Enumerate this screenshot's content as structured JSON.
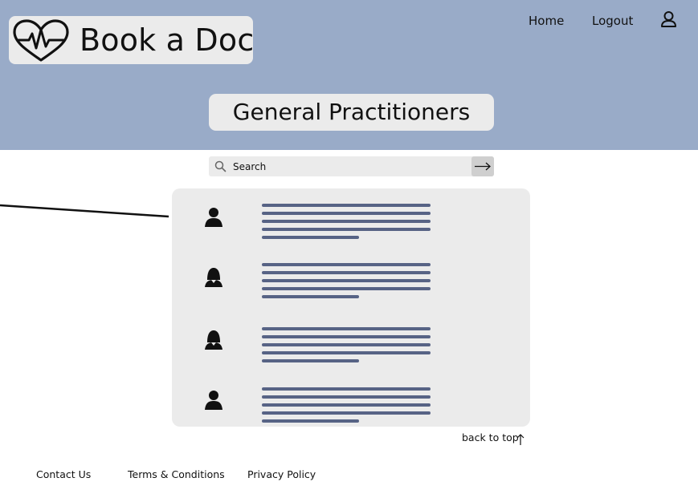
{
  "brand": {
    "name": "Book a Doc",
    "logo_icon": "heart-pulse-icon"
  },
  "nav": {
    "home_label": "Home",
    "logout_label": "Logout",
    "profile_icon": "user-icon"
  },
  "page": {
    "title": "General Practitioners"
  },
  "search": {
    "placeholder": "Search",
    "value": "",
    "search_icon": "search-icon",
    "submit_icon": "arrow-right-icon"
  },
  "results": {
    "items": [
      {
        "avatar_icon": "male-doctor-icon"
      },
      {
        "avatar_icon": "female-doctor-icon"
      },
      {
        "avatar_icon": "female-doctor-icon"
      },
      {
        "avatar_icon": "male-doctor-icon"
      }
    ]
  },
  "back_to_top": {
    "label": "back to top",
    "icon": "arrow-up-icon"
  },
  "footer": {
    "contact_label": "Contact Us",
    "terms_label": "Terms & Conditions",
    "privacy_label": "Privacy Policy"
  },
  "colors": {
    "header_bg": "#99abc8",
    "panel_bg": "#ebebeb",
    "placeholder_line": "#576385",
    "search_button_bg": "#cfcfcf"
  }
}
